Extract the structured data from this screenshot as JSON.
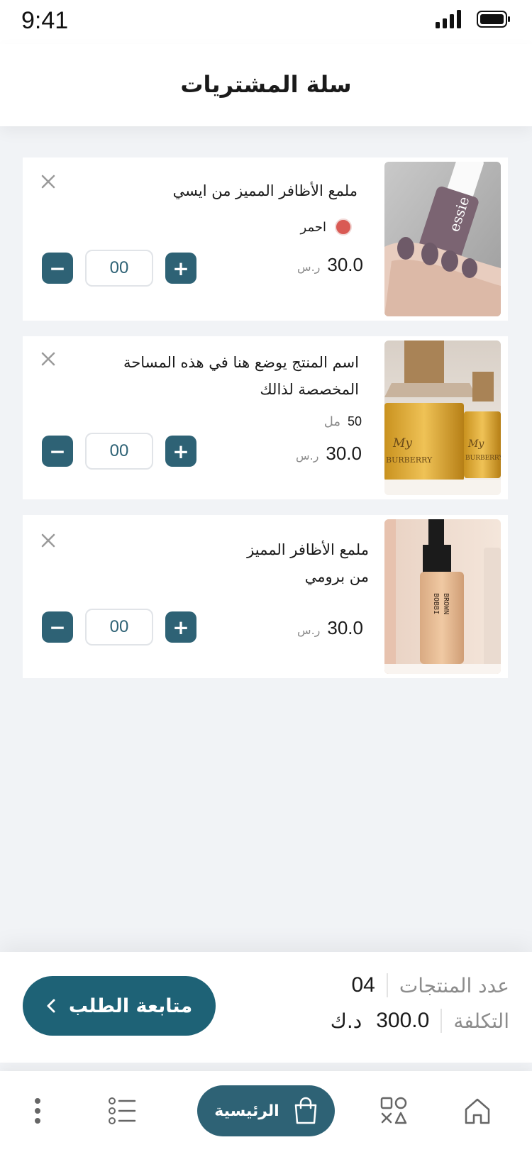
{
  "status_bar": {
    "time": "9:41"
  },
  "header": {
    "title": "سلة المشتريات"
  },
  "cart_items": [
    {
      "name_lines": [
        "ملمع الأظافر المميز من ايسي"
      ],
      "color_label": "احمر",
      "color_hex": "#d95a54",
      "price": "30.0",
      "currency": "ر.س",
      "quantity": "00"
    },
    {
      "name_lines": [
        "اسم المنتج يوضع هنا في هذه المساحة",
        "المخصصة لذالك"
      ],
      "volume_value": "50",
      "volume_unit": "مل",
      "price": "30.0",
      "currency": "ر.س",
      "quantity": "00"
    },
    {
      "name_lines": [
        "ملمع الأظافر المميز",
        "من برومي"
      ],
      "price": "30.0",
      "currency": "ر.س",
      "quantity": "00"
    }
  ],
  "summary": {
    "count_label": "عدد المنتجات",
    "count_value": "04",
    "cost_label": "التكلفة",
    "cost_value": "300.0",
    "cost_currency": "د.ك",
    "checkout_label": "متابعة الطلب"
  },
  "tabbar": {
    "home_label": "الرئيسية"
  },
  "colors": {
    "accent": "#2e6275",
    "checkout": "#1e6276",
    "background": "#f1f3f6"
  }
}
